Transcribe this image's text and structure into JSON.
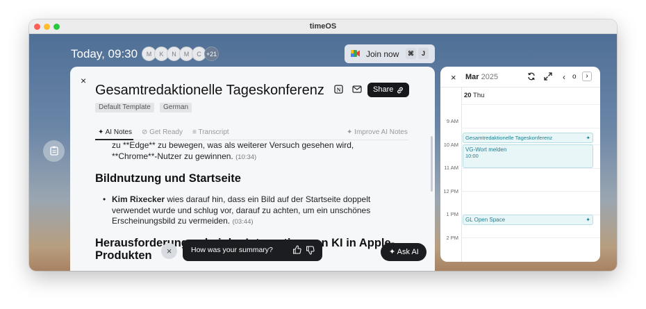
{
  "window": {
    "title": "timeOS",
    "traffic_lights": [
      "#ff5f57",
      "#febc2e",
      "#28c840"
    ]
  },
  "topbar": {
    "today": "Today, 09:30",
    "attendees": [
      "M",
      "K",
      "N",
      "M",
      "C"
    ],
    "attendees_more": "+21",
    "join_label": "Join now",
    "join_keys": [
      "⌘",
      "J"
    ]
  },
  "meeting": {
    "close": "×",
    "title": "Gesamtredaktionelle Tageskonferenz",
    "share_label": "Share",
    "tags": [
      "Default Template",
      "German"
    ],
    "tabs": [
      {
        "icon": "✦",
        "label": "AI Notes"
      },
      {
        "icon": "⊘",
        "label": "Get Ready"
      },
      {
        "icon": "≡",
        "label": "Transcript"
      }
    ],
    "improve_label": "Improve AI Notes",
    "notes": {
      "p1_text": "zu **Edge** zu bewegen, was als weiterer Versuch gesehen wird, **Chrome**-Nutzer zu gewinnen.",
      "p1_ts": "(10:34)",
      "h1": "Bildnutzung und Startseite",
      "b1_name": "Kim Rixecker",
      "b1_text": " wies darauf hin, dass ein Bild auf der Startseite doppelt verwendet wurde und schlug vor, darauf zu achten, um ein unschönes Erscheinungsbild zu vermeiden.",
      "b1_ts": "(03:44)",
      "h2": "Herausforderungen bei der Integration von KI in Apple-Produkten"
    },
    "feedback_close": "×",
    "feedback_question": "How was your summary?",
    "ask_ai_label": "Ask AI"
  },
  "calendar": {
    "close": "×",
    "month": "Mar",
    "year": "2025",
    "today_label": "o",
    "day_num": "20",
    "day_name": "Thu",
    "hours": [
      "9 AM",
      "10 AM",
      "11 AM",
      "12 PM",
      "1 PM",
      "2 PM"
    ],
    "events": [
      {
        "title": "Gesamtredaktionelle Tageskonferenz"
      },
      {
        "title": "VG-Wort melden",
        "time": "10:00"
      },
      {
        "title": "GL Open Space"
      }
    ],
    "accent": "#1f7e8e"
  }
}
